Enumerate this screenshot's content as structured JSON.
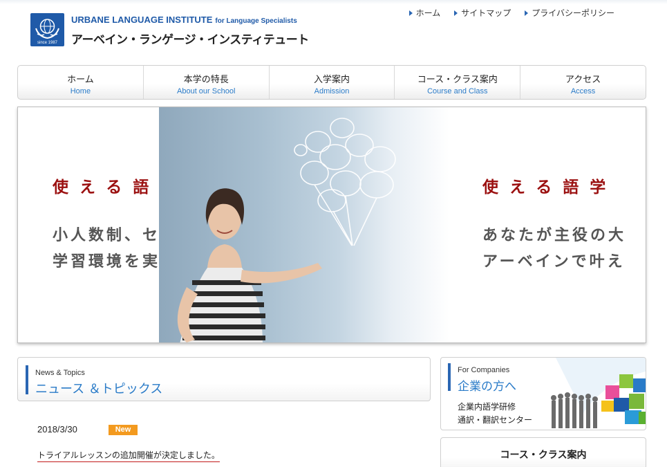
{
  "header": {
    "logo_year": "since 1987",
    "brand_en": "URBANE LANGUAGE INSTITUTE",
    "brand_en_sub": "for Language Specialists",
    "brand_jp": "アーベイン・ランゲージ・インスティテュート"
  },
  "util_nav": [
    {
      "label": "ホーム"
    },
    {
      "label": "サイトマップ"
    },
    {
      "label": "プライバシーポリシー"
    }
  ],
  "global_nav": [
    {
      "jp": "ホーム",
      "en": "Home"
    },
    {
      "jp": "本学の特長",
      "en": "About our School"
    },
    {
      "jp": "入学案内",
      "en": "Admission"
    },
    {
      "jp": "コース・クラス案内",
      "en": "Course and Class"
    },
    {
      "jp": "アクセス",
      "en": "Access"
    }
  ],
  "hero": {
    "left_title": "使える語",
    "left_line1": "小人数制、セミ",
    "left_line2": "学習環境を実",
    "right_title": "使える語学",
    "right_line1": "あなたが主役の大",
    "right_line2": "アーベインで叶え"
  },
  "news": {
    "heading_en": "News & Topics",
    "heading_jp": "ニュース ＆トピックス",
    "items": [
      {
        "date": "2018/3/30",
        "badge": "New",
        "text": "トライアルレッスンの追加開催が決定しました。"
      }
    ]
  },
  "companies": {
    "heading_en": "For Companies",
    "heading_jp": "企業の方へ",
    "line1": "企業内語学研修",
    "line2": "通訳・翻訳センター"
  },
  "course_box": {
    "title": "コース・クラス案内"
  },
  "colors": {
    "brand_blue": "#1f5aa8",
    "link_blue": "#2a7bc8",
    "hero_red": "#9b1010",
    "badge_orange": "#f39a1f"
  }
}
